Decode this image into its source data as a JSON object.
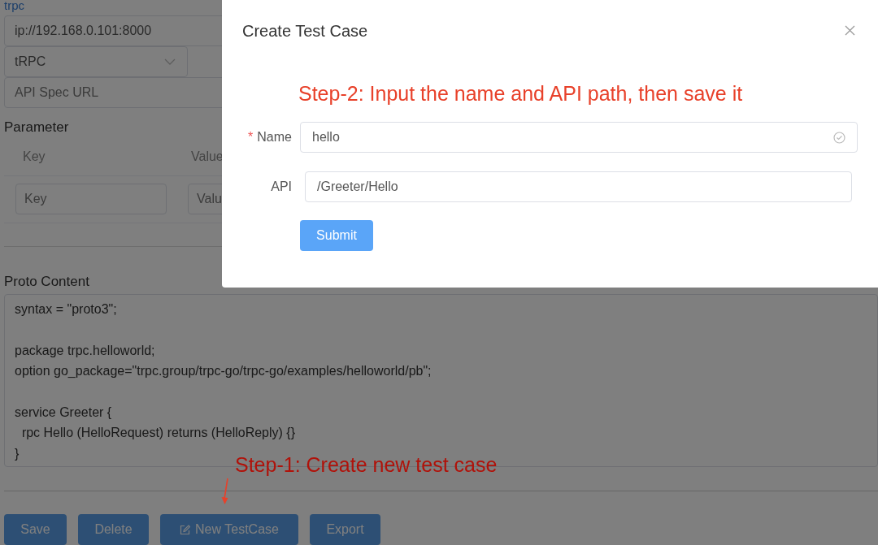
{
  "page": {
    "link": "trpc",
    "url_field": {
      "value": "ip://192.168.0.101:8000"
    },
    "protocol_select": {
      "value": "tRPC"
    },
    "spec_field": {
      "placeholder": "API Spec URL"
    },
    "parameter": {
      "title": "Parameter",
      "columns": [
        "Key",
        "Value"
      ],
      "inputs": [
        {
          "placeholder": "Key"
        },
        {
          "placeholder": "Valu"
        }
      ]
    },
    "proto": {
      "title": "Proto Content",
      "content": "syntax = \"proto3\";\n\npackage trpc.helloworld;\noption go_package=\"trpc.group/trpc-go/trpc-go/examples/helloworld/pb\";\n\nservice Greeter {\n  rpc Hello (HelloRequest) returns (HelloReply) {}\n}"
    },
    "buttons": [
      {
        "label": "Save",
        "kind": "plain"
      },
      {
        "label": "Delete",
        "kind": "plain"
      },
      {
        "label": "New TestCase",
        "kind": "edit"
      },
      {
        "label": "Export",
        "kind": "plain"
      }
    ],
    "annotation": "Step-1: Create new test case"
  },
  "dialog": {
    "title": "Create Test Case",
    "annotation": "Step-2: Input the name and API path, then save it",
    "fields": [
      {
        "marker": "*",
        "label": "Name",
        "value": "hello",
        "valid": true
      },
      {
        "label": "API",
        "value": "/Greeter/Hello",
        "valid": false
      }
    ],
    "submit": "Submit"
  }
}
